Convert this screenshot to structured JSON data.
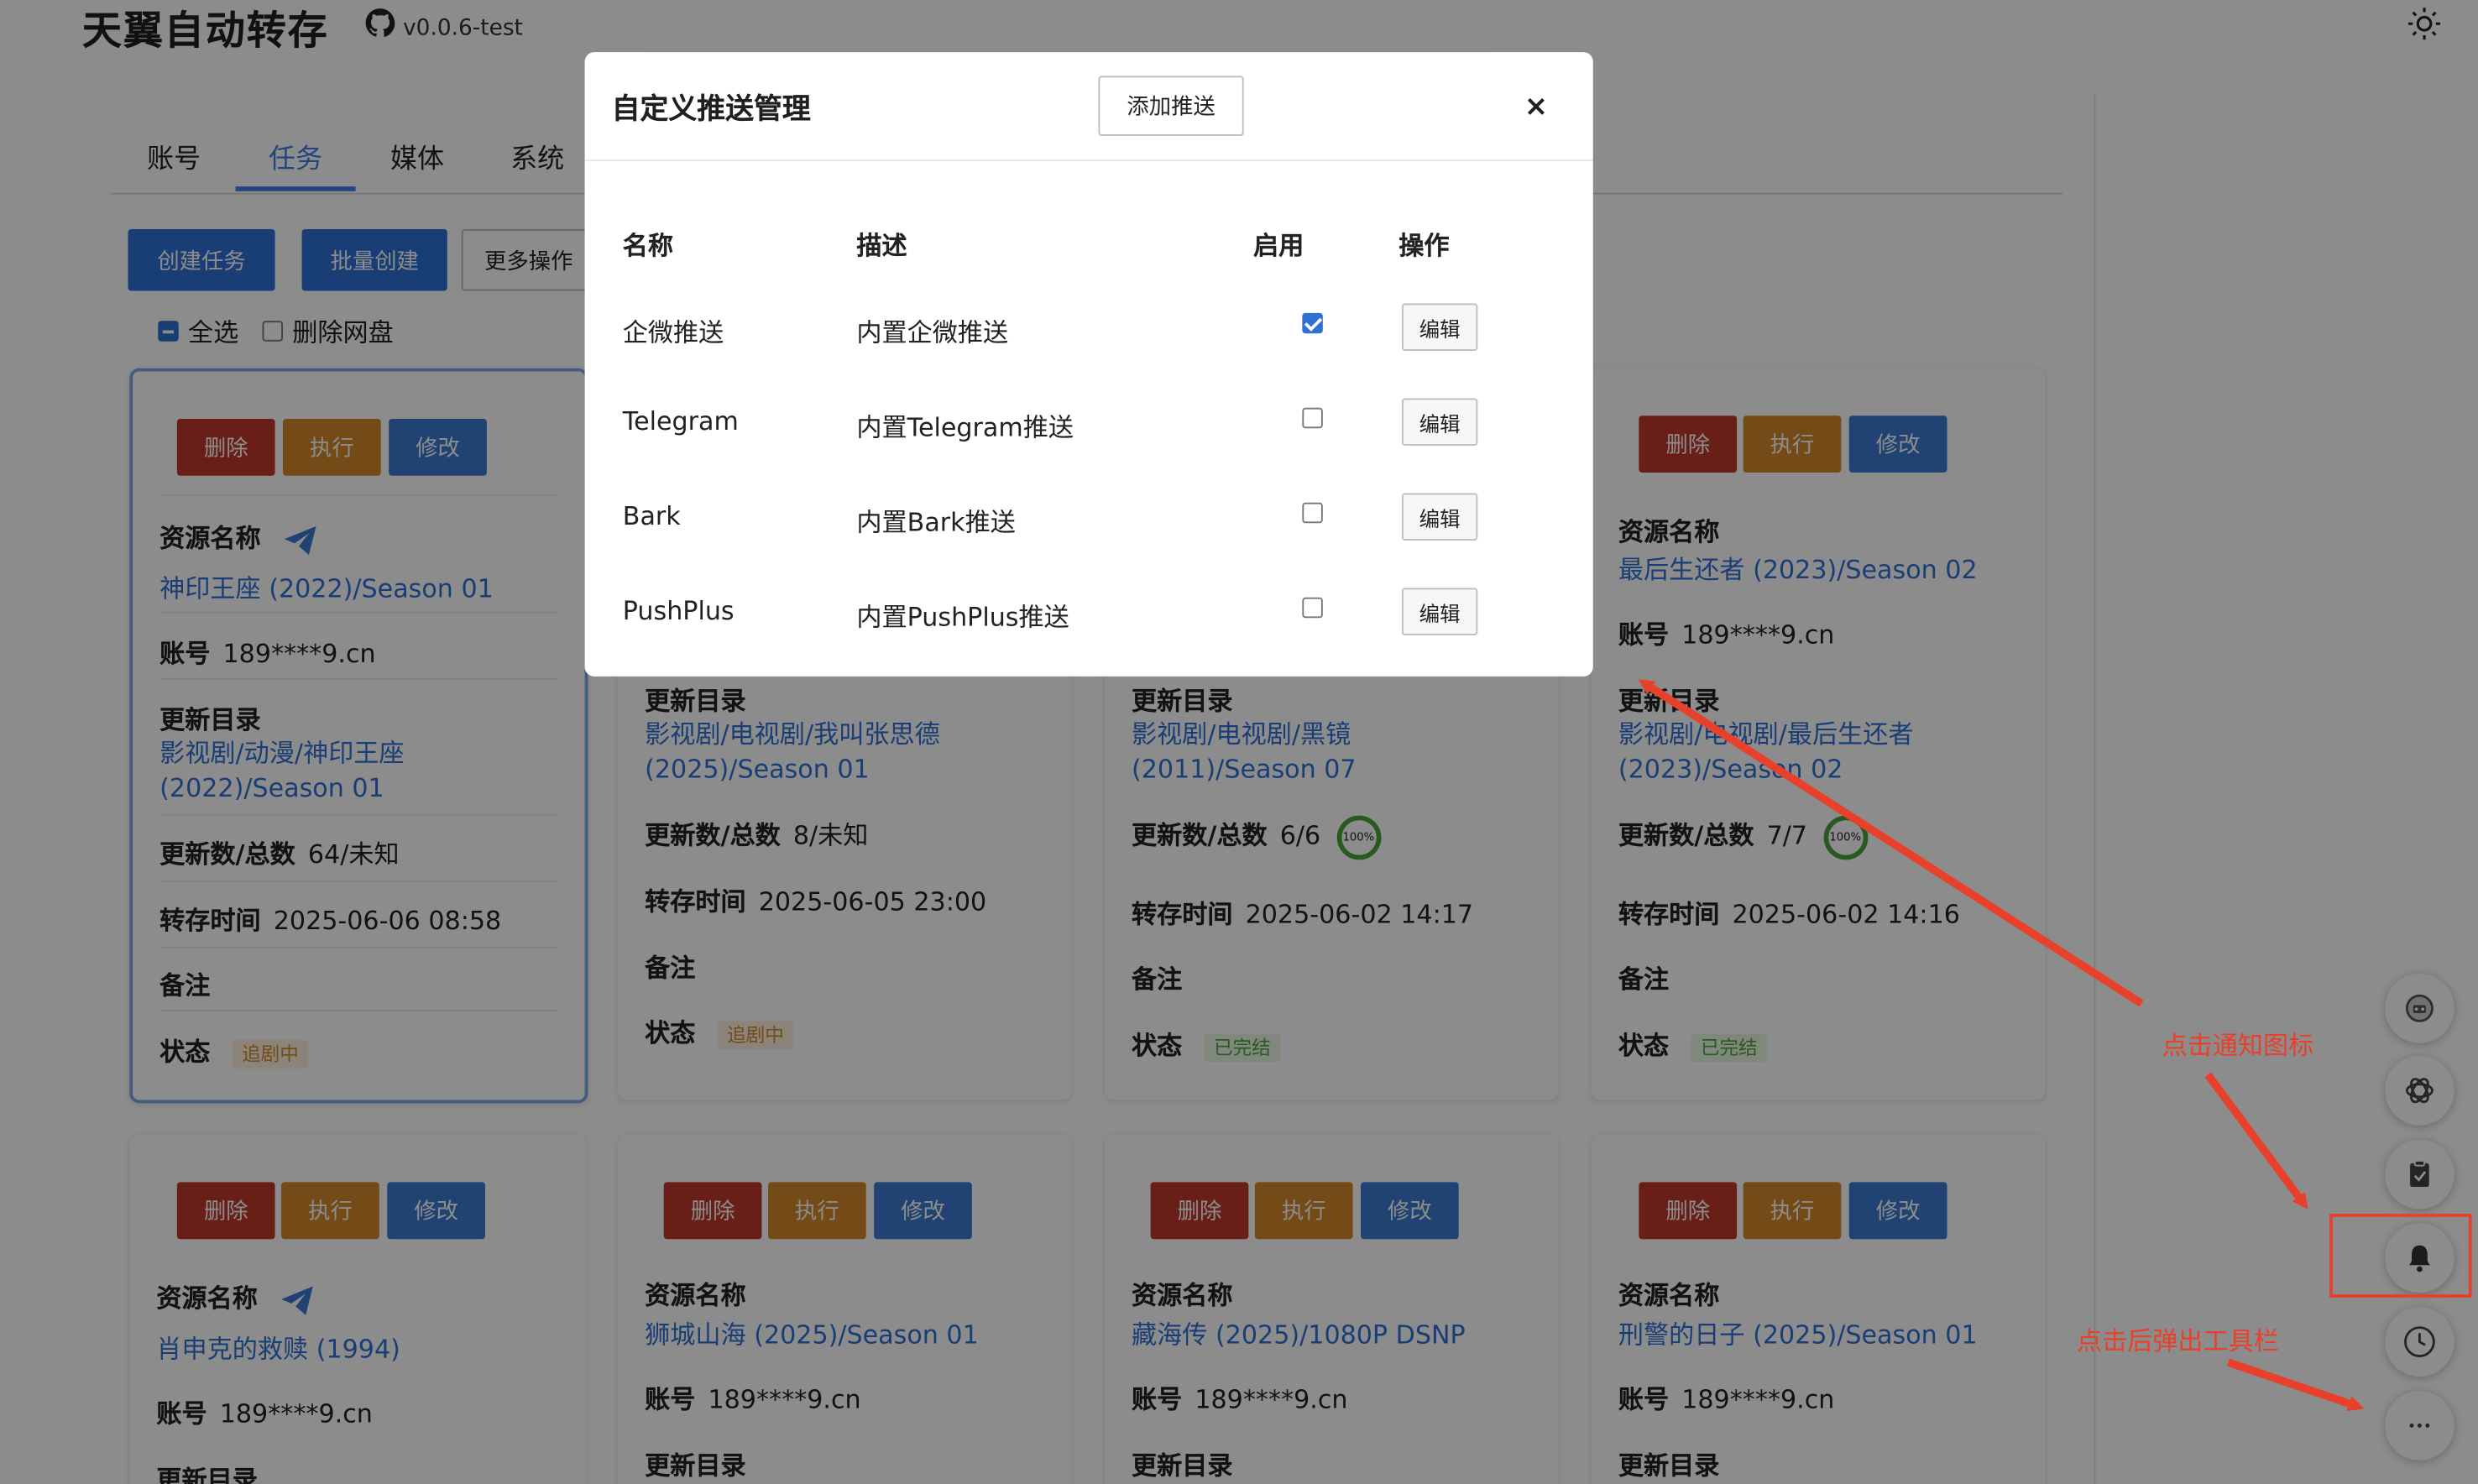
{
  "header": {
    "title": "天翼自动转存",
    "version": "v0.0.6-test"
  },
  "tabs": [
    {
      "label": "账号"
    },
    {
      "label": "任务"
    },
    {
      "label": "媒体"
    },
    {
      "label": "系统"
    }
  ],
  "toolbar": {
    "create": "创建任务",
    "batch_create": "批量创建",
    "more": "更多操作",
    "select_all": "全选",
    "delete_disk": "删除网盘"
  },
  "card_buttons": {
    "delete": "删除",
    "execute": "执行",
    "modify": "修改"
  },
  "labels": {
    "resource": "资源名称",
    "account": "账号",
    "update_dir": "更新目录",
    "count": "更新数/总数",
    "time": "转存时间",
    "remark": "备注",
    "status": "状态"
  },
  "cards": [
    {
      "name": "神印王座 (2022)/Season 01",
      "account": "189****9.cn",
      "dir": "影视剧/动漫/神印王座 (2022)/Season 01",
      "count": "64/未知",
      "time": "2025-06-06 08:58",
      "status": "追剧中"
    },
    {
      "name": "",
      "account": "",
      "dir": "影视剧/电视剧/我叫张思德 (2025)/Season 01",
      "count": "8/未知",
      "time": "2025-06-05 23:00",
      "status": "追剧中"
    },
    {
      "name": "",
      "account": "",
      "dir": "影视剧/电视剧/黑镜 (2011)/Season 07",
      "count": "6/6",
      "progress": "100%",
      "time": "2025-06-02 14:17",
      "status": "已完结"
    },
    {
      "name": "最后生还者 (2023)/Season 02",
      "account": "189****9.cn",
      "dir": "影视剧/电视剧/最后生还者 (2023)/Season 02",
      "count": "7/7",
      "progress": "100%",
      "time": "2025-06-02 14:16",
      "status": "已完结"
    },
    {
      "name": "肖申克的救赎 (1994)",
      "account": "189****9.cn"
    },
    {
      "name": "狮城山海 (2025)/Season 01",
      "account": "189****9.cn"
    },
    {
      "name": "藏海传 (2025)/1080P DSNP",
      "account": "189****9.cn"
    },
    {
      "name": "刑警的日子 (2025)/Season 01",
      "account": "189****9.cn"
    }
  ],
  "modal": {
    "title": "自定义推送管理",
    "add_button": "添加推送",
    "close": "×",
    "columns": {
      "name": "名称",
      "desc": "描述",
      "enabled": "启用",
      "action": "操作"
    },
    "rows": [
      {
        "name": "企微推送",
        "desc": "内置企微推送",
        "enabled": true,
        "action": "编辑"
      },
      {
        "name": "Telegram",
        "desc": "内置Telegram推送",
        "enabled": false,
        "action": "编辑"
      },
      {
        "name": "Bark",
        "desc": "内置Bark推送",
        "enabled": false,
        "action": "编辑"
      },
      {
        "name": "PushPlus",
        "desc": "内置PushPlus推送",
        "enabled": false,
        "action": "编辑"
      }
    ]
  },
  "annotations": {
    "click_bell": "点击通知图标",
    "toolbar_hint": "点击后弹出工具栏"
  },
  "floating_icons": [
    "robot-icon",
    "openai-icon",
    "clipboard-icon",
    "bell-icon",
    "clock-icon",
    "more-icon"
  ],
  "colors": {
    "primary": "#2f6fd6",
    "danger": "#c0392b",
    "warning": "#d4882a",
    "success": "#4aa33a",
    "annotation": "#e8402a"
  }
}
